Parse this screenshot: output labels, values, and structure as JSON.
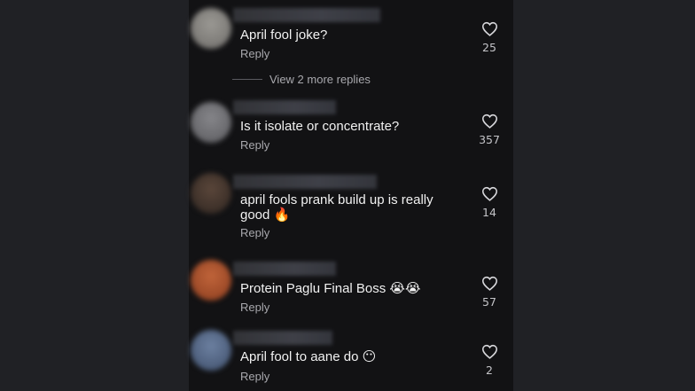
{
  "comments": [
    {
      "text": "April fool joke?",
      "reply_label": "Reply",
      "likes": "25",
      "avatar_color": "#8b8a86"
    },
    {
      "text": "Is it isolate or concentrate?",
      "reply_label": "Reply",
      "likes": "357",
      "avatar_color": "#77777b"
    },
    {
      "text": "april fools prank build up is really good 🔥",
      "reply_label": "Reply",
      "likes": "14",
      "avatar_color": "#4a3a30"
    },
    {
      "text": "Protein Paglu Final Boss 😭😭",
      "reply_label": "Reply",
      "likes": "57",
      "avatar_color": "#b0562f"
    },
    {
      "text": "April fool to aane do 😶",
      "reply_label": "Reply",
      "likes": "2",
      "avatar_color": "#5a6f8f"
    }
  ],
  "thread": {
    "view_more_label": "View 2 more replies"
  }
}
